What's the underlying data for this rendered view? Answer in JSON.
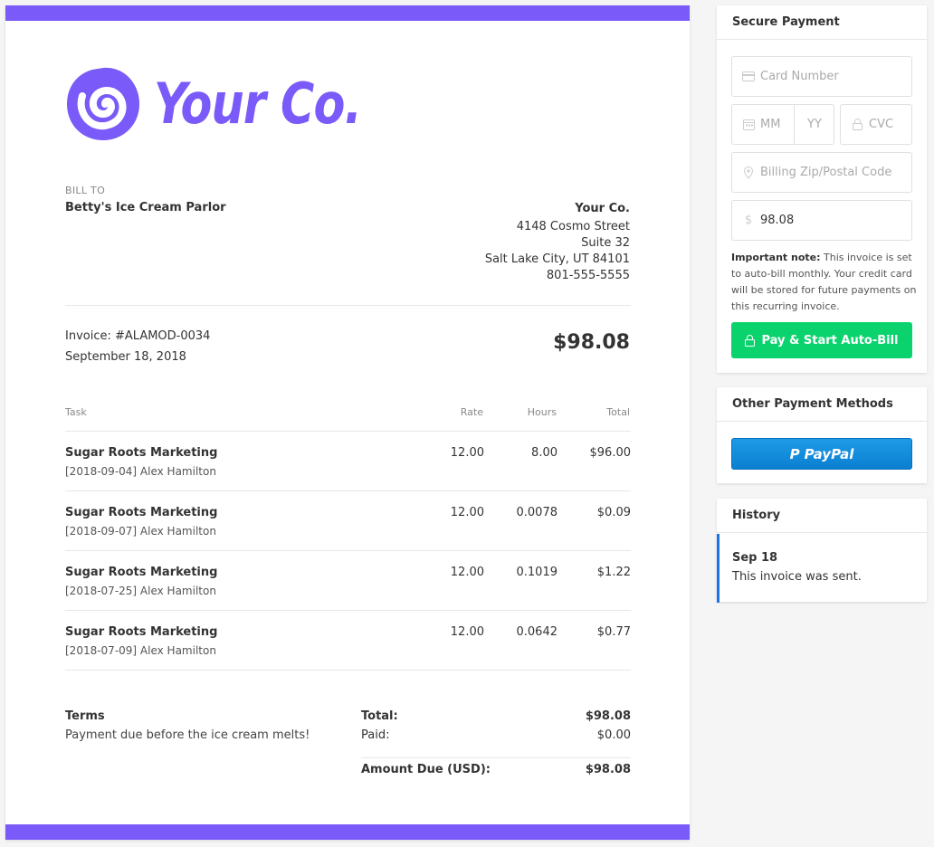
{
  "brand": {
    "name": "Your Co.",
    "accent": "#7a5af8"
  },
  "invoice": {
    "bill_to_label": "BILL TO",
    "bill_to_name": "Betty's Ice Cream Parlor",
    "from": {
      "company": "Your Co.",
      "street": "4148 Cosmo Street",
      "suite": "Suite 32",
      "city": "Salt Lake City, UT 84101",
      "phone": "801-555-5555"
    },
    "number": "Invoice: #ALAMOD-0034",
    "date": "September 18, 2018",
    "amount": "$98.08",
    "columns": {
      "task": "Task",
      "rate": "Rate",
      "hours": "Hours",
      "total": "Total"
    },
    "items": [
      {
        "name": "Sugar Roots Marketing",
        "detail": "[2018-09-04] Alex Hamilton",
        "rate": "12.00",
        "hours": "8.00",
        "total": "$96.00"
      },
      {
        "name": "Sugar Roots Marketing",
        "detail": "[2018-09-07] Alex Hamilton",
        "rate": "12.00",
        "hours": "0.0078",
        "total": "$0.09"
      },
      {
        "name": "Sugar Roots Marketing",
        "detail": "[2018-07-25] Alex Hamilton",
        "rate": "12.00",
        "hours": "0.1019",
        "total": "$1.22"
      },
      {
        "name": "Sugar Roots Marketing",
        "detail": "[2018-07-09] Alex Hamilton",
        "rate": "12.00",
        "hours": "0.0642",
        "total": "$0.77"
      }
    ],
    "terms_label": "Terms",
    "terms_text": "Payment due before the ice cream melts!",
    "totals": {
      "total_label": "Total:",
      "total_value": "$98.08",
      "paid_label": "Paid:",
      "paid_value": "$0.00",
      "due_label": "Amount Due (USD):",
      "due_value": "$98.08"
    }
  },
  "secure_payment": {
    "title": "Secure Payment",
    "card_placeholder": "Card Number",
    "mm_placeholder": "MM",
    "yy_placeholder": "YY",
    "cvc_placeholder": "CVC",
    "zip_placeholder": "Billing Zip/Postal Code",
    "amount_value": "98.08",
    "note_bold": "Important note:",
    "note_text": " This invoice is set to auto-bill monthly. Your credit card will be stored for future payments on this recurring invoice.",
    "pay_button": "Pay & Start Auto-Bill",
    "pay_color": "#0ad36e"
  },
  "other_methods": {
    "title": "Other Payment Methods",
    "paypal_label": "PayPal"
  },
  "history": {
    "title": "History",
    "entries": [
      {
        "date": "Sep 18",
        "text": "This invoice was sent."
      }
    ]
  }
}
